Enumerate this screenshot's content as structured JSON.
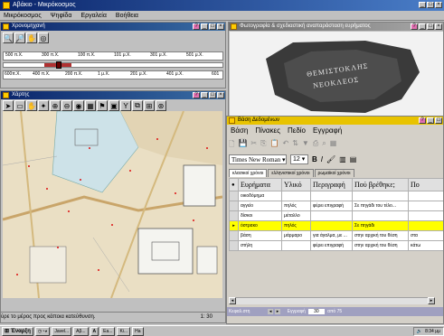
{
  "app": {
    "title": "Αβάκιο - Μικρόκοσμος"
  },
  "menu": [
    "Μικρόκοσμος",
    "Ψηφίδα",
    "Εργαλεία",
    "Βοήθεια"
  ],
  "scale_window": {
    "title": "Χρονομηχανή",
    "top_ruler": [
      "500 π.Χ.",
      "300 π.Χ.",
      "100 π.Χ.",
      "101 μ.Χ.",
      "301 μ.Χ.",
      "501 μ.Χ."
    ],
    "bottom_ruler": [
      "600π.Χ.",
      "400 π.Χ.",
      "200 π.Χ.",
      "1 μ.Χ.",
      "201 μ.Χ.",
      "401 μ.Χ.",
      "601"
    ]
  },
  "map_window": {
    "title": "Χάρτης",
    "status_text": "ύρε το μέρος προς κάποια κατεύθυνση.",
    "zoom": "1: 30"
  },
  "photo_window": {
    "title": "Φωτογραφία & σχεδιαστική αναπαράσταση ευρήματος",
    "inscription_lines": [
      "ΘΕΜΙΣΤΟΚΛΗΣ",
      "ΝΕΟΚΛΕΟΣ"
    ]
  },
  "db_window": {
    "title": "Βάση Δεδομένων",
    "menu": [
      "Βάση",
      "Πίνακες",
      "Πεδίο",
      "Εγγραφή"
    ],
    "font_name": "Times New Roman",
    "font_size": "12",
    "tabs": [
      "κλασικοί χρόνοι",
      "ελληνιστικοί χρόνοι",
      "ρωμαϊκοί χρόνοι"
    ],
    "columns": [
      "Ευρήματα",
      "Υλικό",
      "Περιγραφή",
      "Πού βρέθηκε;",
      "Πο"
    ],
    "rows": [
      [
        "οικοδόμημα",
        "",
        "",
        "",
        ""
      ],
      [
        "αγγείο",
        "πηλός",
        "φέρει επιγραφή",
        "Σε πηγάδι του τέλο...",
        ""
      ],
      [
        "δίσκοι",
        "μέταλλο",
        "",
        "",
        ""
      ],
      [
        "όστρακο",
        "πηλός",
        "",
        "Σε πηγάδι",
        ""
      ],
      [
        "βάση",
        "μάρμαρο",
        "για άγαλμα, με ...",
        "στην αρχική του θέση",
        "στα"
      ],
      [
        "στήλη",
        "",
        "φέρει επιγραφή",
        "στην αρχική του θέση",
        "κάτω"
      ]
    ],
    "selected_row": 3,
    "status": [
      "Κεφαλ.στη",
      "Εγγραφή",
      "30",
      "από 75"
    ]
  },
  "taskbar": {
    "start": "Έναρξη",
    "tasks": [
      "Javel...",
      "Αβ...",
      "A",
      "Ea...",
      "Ki...",
      "Ha"
    ],
    "clock": "8:34 μμ"
  }
}
